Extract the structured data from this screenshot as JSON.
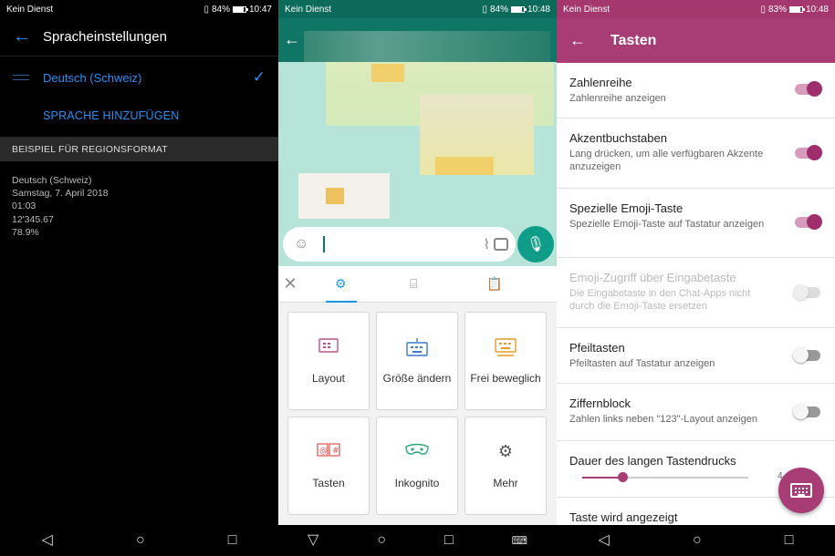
{
  "panel1": {
    "status": {
      "carrier": "Kein Dienst",
      "battery": "84%",
      "time": "10:47"
    },
    "title": "Spracheinstellungen",
    "language": "Deutsch (Schweiz)",
    "add_language": "SPRACHE HINZUFÜGEN",
    "section_header": "BEISPIEL FÜR REGIONSFORMAT",
    "example_lines": [
      "Deutsch (Schweiz)",
      "Samstag, 7. April 2018",
      "01:03",
      "12'345.67",
      "78.9%"
    ]
  },
  "panel2": {
    "status": {
      "carrier": "Kein Dienst",
      "battery": "84%",
      "time": "10:48"
    },
    "tiles": [
      {
        "label": "Layout",
        "icon": "layout-icon",
        "color": "#c0508a"
      },
      {
        "label": "Größe ändern",
        "icon": "resize-icon",
        "color": "#3a7ac8"
      },
      {
        "label": "Frei beweglich",
        "icon": "float-keyboard-icon",
        "color": "#e89a24"
      },
      {
        "label": "Tasten",
        "icon": "keys-icon",
        "color": "#e0504c"
      },
      {
        "label": "Inkognito",
        "icon": "incognito-icon",
        "color": "#2aa876"
      },
      {
        "label": "Mehr",
        "icon": "more-settings-icon",
        "color": "#555555"
      }
    ]
  },
  "panel3": {
    "status": {
      "carrier": "Kein Dienst",
      "battery": "83%",
      "time": "10:48"
    },
    "title": "Tasten",
    "settings": [
      {
        "title": "Zahlenreihe",
        "sub": "Zahlenreihe anzeigen",
        "state": "on"
      },
      {
        "title": "Akzentbuchstaben",
        "sub": "Lang drücken, um alle verfügbaren Akzente anzuzeigen",
        "state": "on"
      },
      {
        "title": "Spezielle Emoji-Taste",
        "sub": "Spezielle Emoji-Taste auf Tastatur anzeigen",
        "state": "on"
      },
      {
        "title": "Emoji-Zugriff über Eingabetaste",
        "sub": "Die Eingabetaste in den Chat-Apps nicht durch die Emoji-Taste ersetzen",
        "state": "disabled"
      },
      {
        "title": "Pfeiltasten",
        "sub": "Pfeiltasten auf Tastatur anzeigen",
        "state": "off"
      },
      {
        "title": "Ziffernblock",
        "sub": "Zahlen links neben \"123\"-Layout anzeigen",
        "state": "off"
      }
    ],
    "long_press": {
      "title": "Dauer des langen Tastendrucks",
      "value_label": "4",
      "fraction": 0.24
    },
    "last_item": "Taste wird angezeigt",
    "accent": "#a83c74"
  }
}
